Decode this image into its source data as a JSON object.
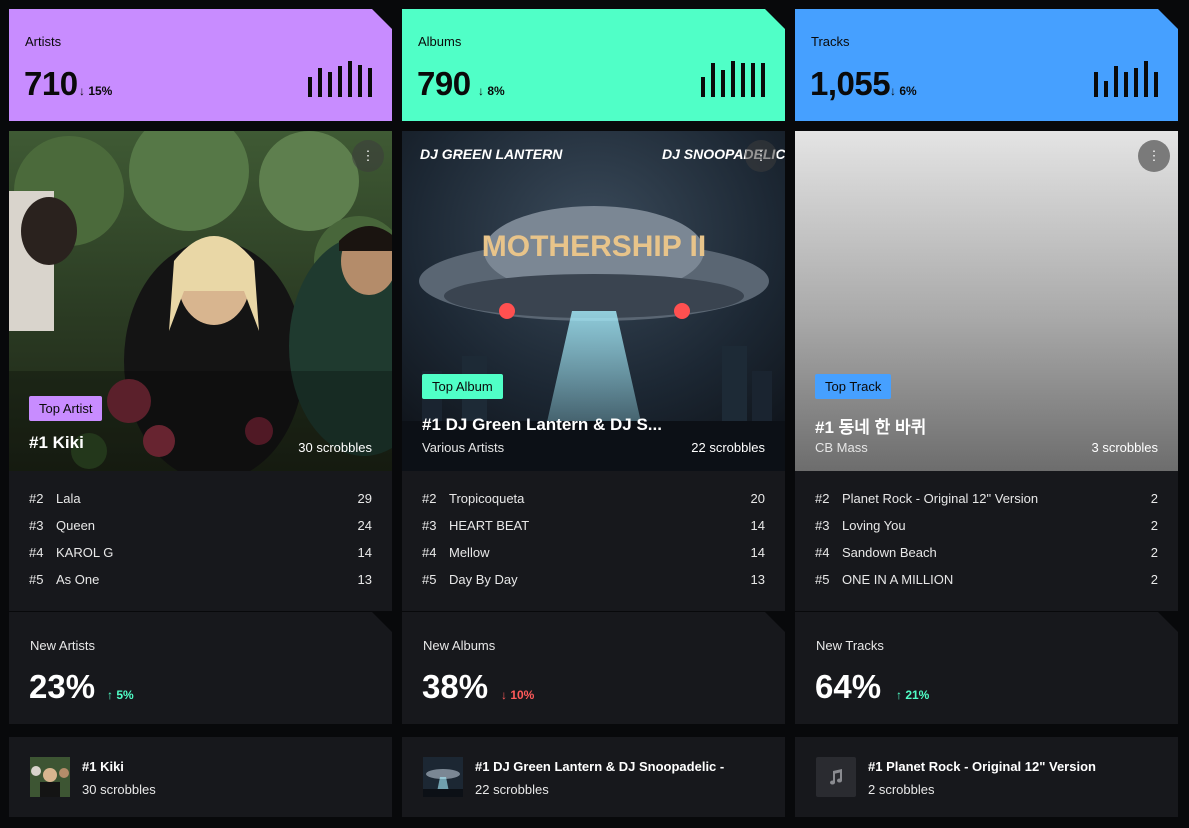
{
  "stats": [
    {
      "label": "Artists",
      "value": "710",
      "delta": "↓ 15%",
      "color": "#c88cff",
      "bars": [
        0.55,
        0.8,
        0.7,
        0.85,
        1.0,
        0.9,
        0.8
      ]
    },
    {
      "label": "Albums",
      "value": "790",
      "delta": "↓ 8%",
      "color": "#50ffc7",
      "bars": [
        0.55,
        0.95,
        0.75,
        1.0,
        0.95,
        0.95,
        0.95
      ]
    },
    {
      "label": "Tracks",
      "value": "1,055",
      "delta": "↓ 6%",
      "color": "#46a0ff",
      "bars": [
        0.7,
        0.45,
        0.85,
        0.7,
        0.8,
        1.0,
        0.7
      ]
    }
  ],
  "top": [
    {
      "tag": "Top Artist",
      "tag_color": "#c88cff",
      "title": "#1 Kiki",
      "subtitle": "",
      "scrobbles": "30 scrobbles",
      "list": [
        {
          "rank": "#2",
          "name": "Lala",
          "count": "29"
        },
        {
          "rank": "#3",
          "name": "Queen",
          "count": "24"
        },
        {
          "rank": "#4",
          "name": "KAROL G",
          "count": "14"
        },
        {
          "rank": "#5",
          "name": "As One",
          "count": "13"
        }
      ]
    },
    {
      "tag": "Top Album",
      "tag_color": "#50ffc7",
      "title": "#1 DJ Green Lantern & DJ S...",
      "subtitle": "Various Artists",
      "scrobbles": "22 scrobbles",
      "art_top_left": "DJ GREEN LANTERN",
      "art_top_right": "DJ SNOOPADELIC",
      "art_title": "MOTHERSHIP II",
      "list": [
        {
          "rank": "#2",
          "name": "Tropicoqueta",
          "count": "20"
        },
        {
          "rank": "#3",
          "name": "HEART BEAT",
          "count": "14"
        },
        {
          "rank": "#4",
          "name": "Mellow",
          "count": "14"
        },
        {
          "rank": "#5",
          "name": "Day By Day",
          "count": "13"
        }
      ]
    },
    {
      "tag": "Top Track",
      "tag_color": "#46a0ff",
      "title": "#1 동네 한 바퀴",
      "subtitle": "CB Mass",
      "scrobbles": "3 scrobbles",
      "list": [
        {
          "rank": "#2",
          "name": "Planet Rock - Original 12\" Version",
          "count": "2"
        },
        {
          "rank": "#3",
          "name": "Loving You",
          "count": "2"
        },
        {
          "rank": "#4",
          "name": "Sandown Beach",
          "count": "2"
        },
        {
          "rank": "#5",
          "name": "ONE IN A MILLION",
          "count": "2"
        }
      ]
    }
  ],
  "new": [
    {
      "label": "New Artists",
      "value": "23%",
      "delta": "↑ 5%",
      "delta_color": "#50ffc7"
    },
    {
      "label": "New Albums",
      "value": "38%",
      "delta": "↓ 10%",
      "delta_color": "#ff5a5a"
    },
    {
      "label": "New Tracks",
      "value": "64%",
      "delta": "↑ 21%",
      "delta_color": "#50ffc7"
    }
  ],
  "mini": [
    {
      "title": "#1 Kiki",
      "sub": "30 scrobbles",
      "icon": "photo"
    },
    {
      "title": "#1 DJ Green Lantern & DJ Snoopadelic -",
      "sub": "22 scrobbles",
      "icon": "album-art"
    },
    {
      "title": "#1 Planet Rock - Original 12\" Version",
      "sub": "2 scrobbles",
      "icon": "music-note-icon"
    }
  ],
  "menu_glyph": "⋮"
}
